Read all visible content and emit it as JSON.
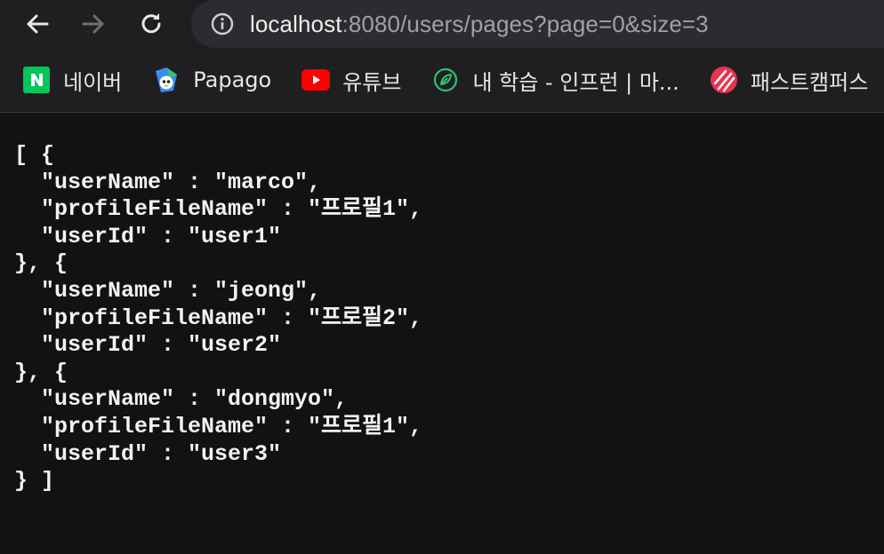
{
  "browser": {
    "url_host": "localhost",
    "url_rest": ":8080/users/pages?page=0&size=3",
    "icons": {
      "back": "arrow-left-icon",
      "forward": "arrow-right-icon",
      "reload": "reload-icon",
      "info": "info-icon"
    }
  },
  "bookmarks": [
    {
      "label": "네이버",
      "icon": "naver-icon",
      "color": "#03c75a"
    },
    {
      "label": "Papago",
      "icon": "papago-icon",
      "color": "#3b8cf0"
    },
    {
      "label": "유튜브",
      "icon": "youtube-icon",
      "color": "#ff0000"
    },
    {
      "label": "내 학습 - 인프런 | 마...",
      "icon": "inflearn-icon",
      "color": "#2fbf71"
    },
    {
      "label": "패스트캠퍼스",
      "icon": "fastcampus-icon",
      "color": "#e8344e"
    }
  ],
  "json_output": "[ {\n  \"userName\" : \"marco\",\n  \"profileFileName\" : \"프로필1\",\n  \"userId\" : \"user1\"\n}, {\n  \"userName\" : \"jeong\",\n  \"profileFileName\" : \"프로필2\",\n  \"userId\" : \"user2\"\n}, {\n  \"userName\" : \"dongmyo\",\n  \"profileFileName\" : \"프로필1\",\n  \"userId\" : \"user3\"\n} ]"
}
